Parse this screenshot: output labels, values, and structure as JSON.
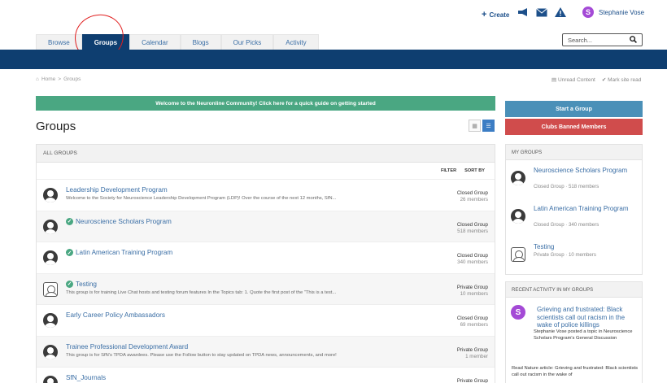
{
  "header": {
    "create_label": "Create",
    "user_name": "Stephanie Vose",
    "user_initial": "S",
    "icons": [
      "megaphone-icon",
      "mail-icon",
      "alert-icon"
    ]
  },
  "nav": {
    "tabs": [
      {
        "label": "Browse"
      },
      {
        "label": "Groups"
      },
      {
        "label": "Calendar"
      },
      {
        "label": "Blogs"
      },
      {
        "label": "Our Picks"
      },
      {
        "label": "Activity"
      }
    ],
    "active_tab": "Groups",
    "search_placeholder": "Search..."
  },
  "breadcrumb": {
    "home": "Home",
    "sep": ">",
    "current": "Groups",
    "unread": "Unread Content",
    "mark_read": "Mark site read"
  },
  "welcome_banner": "Welcome to the Neuronline Community! Click here for a quick guide on getting started",
  "page_title": "Groups",
  "groups_panel": {
    "heading": "ALL GROUPS",
    "filter_label": "FILTER",
    "sort_label": "SORT BY",
    "rows": [
      {
        "title": "Leadership Development Program",
        "verified": false,
        "desc": "Welcome to the Society for Neuroscience Leadership Development Program (LDP)! Over the course of the next 12 months, SfN...",
        "type": "Closed Group",
        "members": "26 members",
        "avatar": "person"
      },
      {
        "title": "Neuroscience Scholars Program",
        "verified": true,
        "desc": "",
        "type": "Closed Group",
        "members": "518 members",
        "avatar": "person"
      },
      {
        "title": "Latin American Training Program",
        "verified": true,
        "desc": "",
        "type": "Closed Group",
        "members": "340 members",
        "avatar": "person"
      },
      {
        "title": "Testing",
        "verified": true,
        "desc": "This group is for training Live Chat hosts and testing forum features In the Topics tab: 1. Quote the first post of the \"This is a test...",
        "type": "Private Group",
        "members": "10 members",
        "avatar": "sketch"
      },
      {
        "title": "Early Career Policy Ambassadors",
        "verified": false,
        "desc": "",
        "type": "Closed Group",
        "members": "69 members",
        "avatar": "person"
      },
      {
        "title": "Trainee Professional Development Award",
        "verified": false,
        "desc": "This group is for SfN's TPDA awardees. Please use the Follow button to stay updated on TPDA news, announcements, and more!",
        "type": "Private Group",
        "members": "1 member",
        "avatar": "person"
      },
      {
        "title": "SfN_Journals",
        "verified": false,
        "desc": "",
        "type": "Private Group",
        "members": "",
        "avatar": "person"
      }
    ]
  },
  "sidebar": {
    "start_group": "Start a Group",
    "clubs_banned": "Clubs Banned Members",
    "my_groups_heading": "MY GROUPS",
    "my_groups": [
      {
        "name": "Neuroscience Scholars Program",
        "meta": "Closed Group · 518 members",
        "avatar": "person"
      },
      {
        "name": "Latin American Training Program",
        "meta": "Closed Group · 340 members",
        "avatar": "person"
      },
      {
        "name": "Testing",
        "meta": "Private Group · 10 members",
        "avatar": "sketch"
      }
    ],
    "recent_heading": "RECENT ACTIVITY IN MY GROUPS",
    "recent_title": "Grieving and frustrated: Black scientists call out racism in the wake of police killings",
    "recent_text": "Stephanie Vose posted a topic in Neuroscience Scholars Program's General Discussion",
    "recent_text2": "Read Nature article: Grieving and frustrated: Black scientists call out racism in the wake of"
  },
  "colors": {
    "navy": "#0e3e70",
    "link_blue": "#3a6ea5",
    "green": "#4aa782",
    "start_blue": "#4a90b8",
    "red": "#d04c4c",
    "purple": "#a44ad6"
  }
}
